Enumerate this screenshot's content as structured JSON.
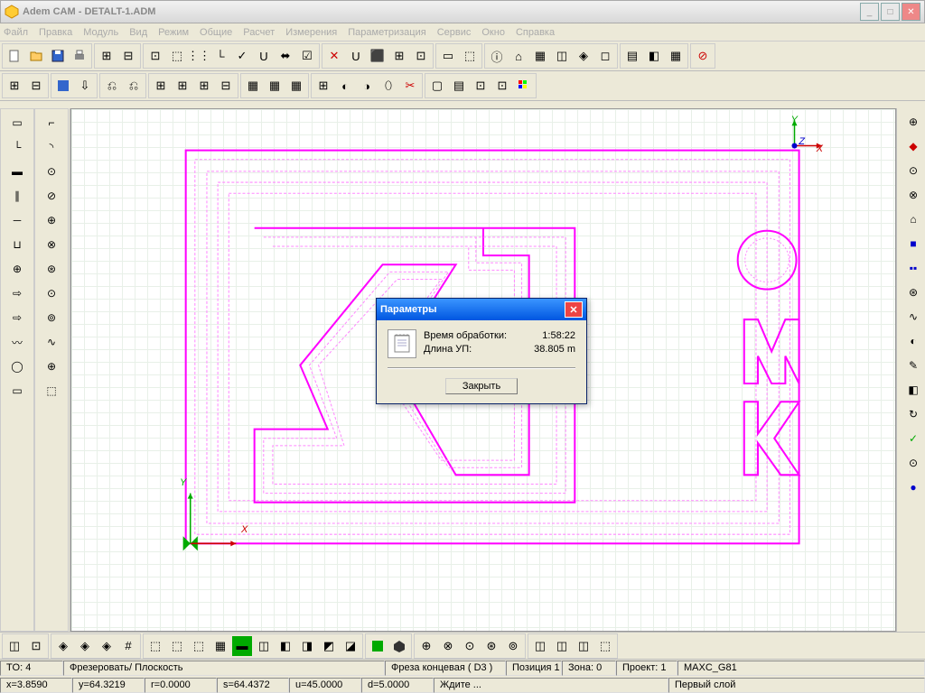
{
  "window": {
    "title": "Adem CAM - DETALT-1.ADM"
  },
  "menu": [
    "Файл",
    "Правка",
    "Модуль",
    "Вид",
    "Режим",
    "Общие",
    "Расчет",
    "Измерения",
    "Параметризация",
    "Сервис",
    "Окно",
    "Справка"
  ],
  "dialog": {
    "title": "Параметры",
    "time_label": "Время обработки:",
    "time_value": "1:58:22",
    "length_label": "Длина УП:",
    "length_value": "38.805 m",
    "close_btn": "Закрыть"
  },
  "status": {
    "to": "TO: 4",
    "op": "Фрезеровать/ Плоскость",
    "tool": "Фреза концевая ( D3 )",
    "pos": "Позиция 1",
    "zone": "Зона: 0",
    "project": "Проект: 1",
    "maxc": "MAXC_G81",
    "x": "x=3.8590",
    "y": "y=64.3219",
    "r": "r=0.0000",
    "s": "s=64.4372",
    "u": "u=45.0000",
    "d": "d=5.0000",
    "wait": "Ждите ...",
    "layer": "Первый слой"
  },
  "axes": {
    "x": "X",
    "y": "Y",
    "z": "Z"
  }
}
